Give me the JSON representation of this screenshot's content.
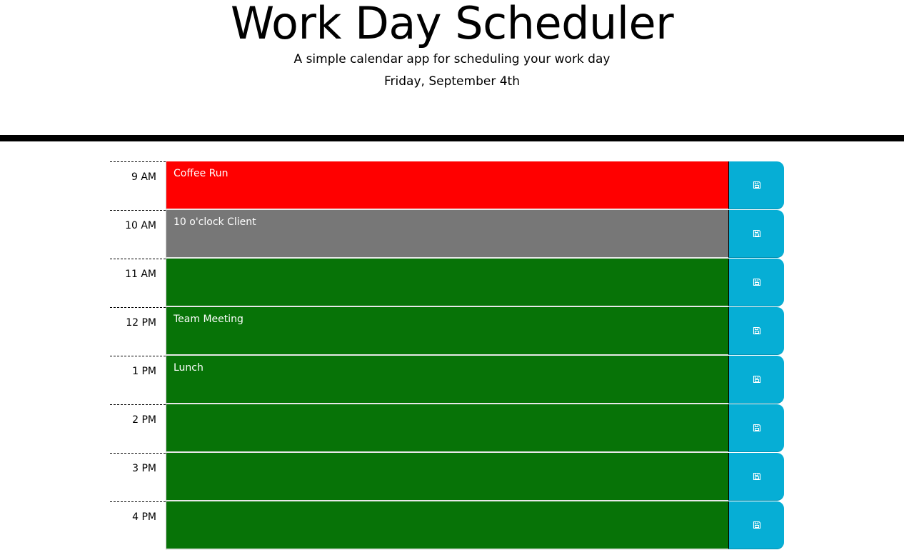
{
  "header": {
    "title": "Work Day Scheduler",
    "subtitle": "A simple calendar app for scheduling your work day",
    "current_day": "Friday, September 4th"
  },
  "colors": {
    "past": "#777777",
    "present": "#ff0000",
    "future": "#077307",
    "save_button": "#06aed5"
  },
  "timeblocks": [
    {
      "hour": "9 AM",
      "text": "Coffee Run",
      "status": "present",
      "save_icon": "save-icon"
    },
    {
      "hour": "10 AM",
      "text": "10 o'clock Client",
      "status": "past",
      "save_icon": "save-icon"
    },
    {
      "hour": "11 AM",
      "text": "",
      "status": "future",
      "save_icon": "save-icon"
    },
    {
      "hour": "12 PM",
      "text": "Team Meeting",
      "status": "future",
      "save_icon": "save-icon"
    },
    {
      "hour": "1 PM",
      "text": "Lunch",
      "status": "future",
      "save_icon": "save-icon"
    },
    {
      "hour": "2 PM",
      "text": "",
      "status": "future",
      "save_icon": "save-icon"
    },
    {
      "hour": "3 PM",
      "text": "",
      "status": "future",
      "save_icon": "save-icon"
    },
    {
      "hour": "4 PM",
      "text": "",
      "status": "future",
      "save_icon": "save-icon"
    }
  ]
}
